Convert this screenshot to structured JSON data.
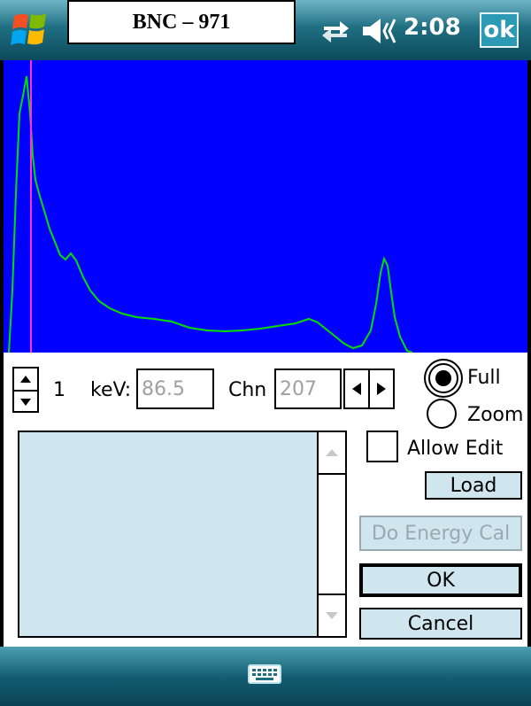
{
  "titlebar": {
    "start_icon": "windows-flag-icon",
    "title": "BNC – 971",
    "clock": "2:08",
    "ok_label": "ok",
    "icons": [
      "sync-icon",
      "speaker-icon"
    ]
  },
  "spectrum": {
    "background": "#0000ff",
    "trace_color": "#00e000",
    "marker_color": "#ff33cc"
  },
  "controls": {
    "index_value": "1",
    "kev_label": "keV:",
    "kev_value": "86.5",
    "chn_label": "Chn",
    "chn_value": "207",
    "radio_full": "Full",
    "radio_zoom": "Zoom",
    "selected_view": "Full",
    "allow_edit_label": "Allow Edit",
    "allow_edit_checked": false
  },
  "buttons": {
    "load": "Load",
    "energy_cal": "Do Energy Cal",
    "ok": "OK",
    "cancel": "Cancel"
  },
  "bottombar": {
    "icon": "keyboard-icon"
  }
}
